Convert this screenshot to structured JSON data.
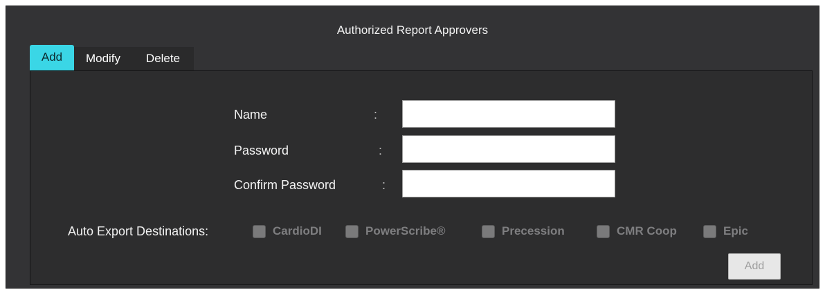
{
  "dialog": {
    "title": "Authorized Report Approvers"
  },
  "tabs": [
    {
      "label": "Add",
      "active": true
    },
    {
      "label": "Modify",
      "active": false
    },
    {
      "label": "Delete",
      "active": false
    }
  ],
  "form": {
    "name": {
      "label": "Name",
      "separator": ":",
      "value": ""
    },
    "password": {
      "label": "Password",
      "separator": ":",
      "value": ""
    },
    "confirm_password": {
      "label": "Confirm Password",
      "separator": ":",
      "value": ""
    }
  },
  "auto_export": {
    "label": "Auto Export Destinations:",
    "destinations": [
      {
        "label": "CardioDI",
        "checked": false,
        "enabled": false
      },
      {
        "label": "PowerScribe®",
        "checked": false,
        "enabled": false
      },
      {
        "label": "Precession",
        "checked": false,
        "enabled": false
      },
      {
        "label": "CMR Coop",
        "checked": false,
        "enabled": false
      },
      {
        "label": "Epic",
        "checked": false,
        "enabled": false
      }
    ]
  },
  "actions": {
    "add_label": "Add",
    "add_enabled": false
  },
  "colors": {
    "panel_bg": "#333335",
    "tab_active": "#3ad6e6",
    "disabled_text": "#7e7e80"
  }
}
